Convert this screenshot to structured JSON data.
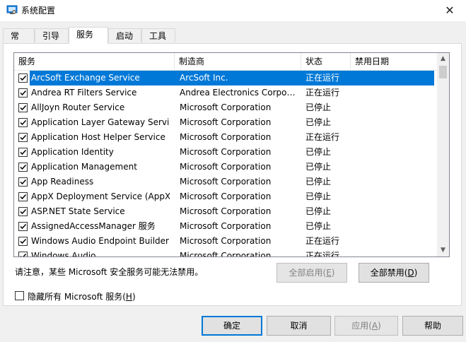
{
  "window": {
    "title": "系统配置",
    "close_label": "✕"
  },
  "tabs": [
    {
      "label": "常规",
      "active": false
    },
    {
      "label": "引导",
      "active": false
    },
    {
      "label": "服务",
      "active": true
    },
    {
      "label": "启动",
      "active": false
    },
    {
      "label": "工具",
      "active": false
    }
  ],
  "list": {
    "headers": {
      "name": "服务",
      "manufacturer": "制造商",
      "status": "状态",
      "disabled_date": "禁用日期"
    },
    "rows": [
      {
        "name": "ArcSoft Exchange Service",
        "manufacturer": "ArcSoft Inc.",
        "status": "正在运行",
        "disabled_date": "",
        "checked": true,
        "selected": true
      },
      {
        "name": "Andrea RT Filters Service",
        "manufacturer": "Andrea Electronics Corpor...",
        "status": "正在运行",
        "disabled_date": "",
        "checked": true,
        "selected": false
      },
      {
        "name": "AllJoyn Router Service",
        "manufacturer": "Microsoft Corporation",
        "status": "已停止",
        "disabled_date": "",
        "checked": true,
        "selected": false
      },
      {
        "name": "Application Layer Gateway Service",
        "manufacturer": "Microsoft Corporation",
        "status": "已停止",
        "disabled_date": "",
        "checked": true,
        "selected": false
      },
      {
        "name": "Application Host Helper Service",
        "manufacturer": "Microsoft Corporation",
        "status": "正在运行",
        "disabled_date": "",
        "checked": true,
        "selected": false
      },
      {
        "name": "Application Identity",
        "manufacturer": "Microsoft Corporation",
        "status": "已停止",
        "disabled_date": "",
        "checked": true,
        "selected": false
      },
      {
        "name": "Application Management",
        "manufacturer": "Microsoft Corporation",
        "status": "已停止",
        "disabled_date": "",
        "checked": true,
        "selected": false
      },
      {
        "name": "App Readiness",
        "manufacturer": "Microsoft Corporation",
        "status": "已停止",
        "disabled_date": "",
        "checked": true,
        "selected": false
      },
      {
        "name": "AppX Deployment Service (AppX...",
        "manufacturer": "Microsoft Corporation",
        "status": "已停止",
        "disabled_date": "",
        "checked": true,
        "selected": false
      },
      {
        "name": "ASP.NET State Service",
        "manufacturer": "Microsoft Corporation",
        "status": "已停止",
        "disabled_date": "",
        "checked": true,
        "selected": false
      },
      {
        "name": "AssignedAccessManager 服务",
        "manufacturer": "Microsoft Corporation",
        "status": "已停止",
        "disabled_date": "",
        "checked": true,
        "selected": false
      },
      {
        "name": "Windows Audio Endpoint Builder",
        "manufacturer": "Microsoft Corporation",
        "status": "正在运行",
        "disabled_date": "",
        "checked": true,
        "selected": false
      },
      {
        "name": "Windows Audio",
        "manufacturer": "Microsoft Corporation",
        "status": "正在运行",
        "disabled_date": "",
        "checked": true,
        "selected": false
      }
    ]
  },
  "scrollbar": {
    "up_arrow": "▲",
    "down_arrow": "▼"
  },
  "notice": "请注意，某些 Microsoft 安全服务可能无法禁用。",
  "enable_all": {
    "label": "全部启用(",
    "key": "E",
    "end": ")"
  },
  "disable_all": {
    "label": "全部禁用(",
    "key": "D",
    "end": ")"
  },
  "hide_ms": {
    "label": "隐藏所有 Microsoft 服务(",
    "key": "H",
    "end": ")",
    "checked": false
  },
  "footer": {
    "ok": "确定",
    "cancel": "取消",
    "apply": {
      "label": "应用(",
      "key": "A",
      "end": ")"
    },
    "help": "帮助"
  },
  "colors": {
    "selection": "#0078d7",
    "title_icon": "#1e88e5"
  }
}
